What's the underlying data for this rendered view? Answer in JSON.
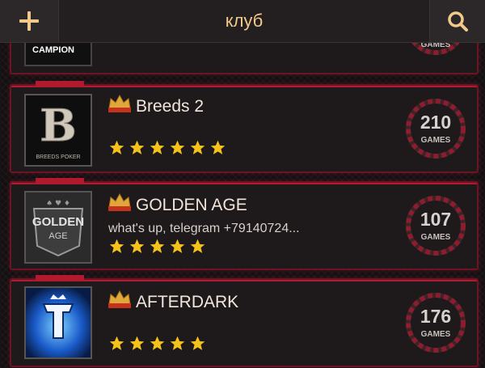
{
  "header": {
    "title": "клуб",
    "add_icon": "plus-icon",
    "search_icon": "search-icon"
  },
  "clubs": [
    {
      "name": "",
      "logo_text": "CAMPION",
      "games_label": "GAMES",
      "rating": 0
    },
    {
      "name": "Breeds 2",
      "logo_text": "BREEDS POKER",
      "badge": "UNION",
      "description": "",
      "games": "210",
      "games_label": "GAMES",
      "rating": 6
    },
    {
      "name": "GOLDEN AGE",
      "logo_text_top": "GOLDEN",
      "logo_text_bottom": "AGE",
      "badge": "UNION",
      "description": "what's up, telegram +79140724...",
      "games": "107",
      "games_label": "GAMES",
      "rating": 5
    },
    {
      "name": "AFTERDARK",
      "badge": "UNION",
      "description": "",
      "games": "176",
      "games_label": "GAMES",
      "rating": 5
    }
  ],
  "colors": {
    "accent": "#b1192f",
    "title": "#f2c98a",
    "star": "#f5c21b"
  }
}
